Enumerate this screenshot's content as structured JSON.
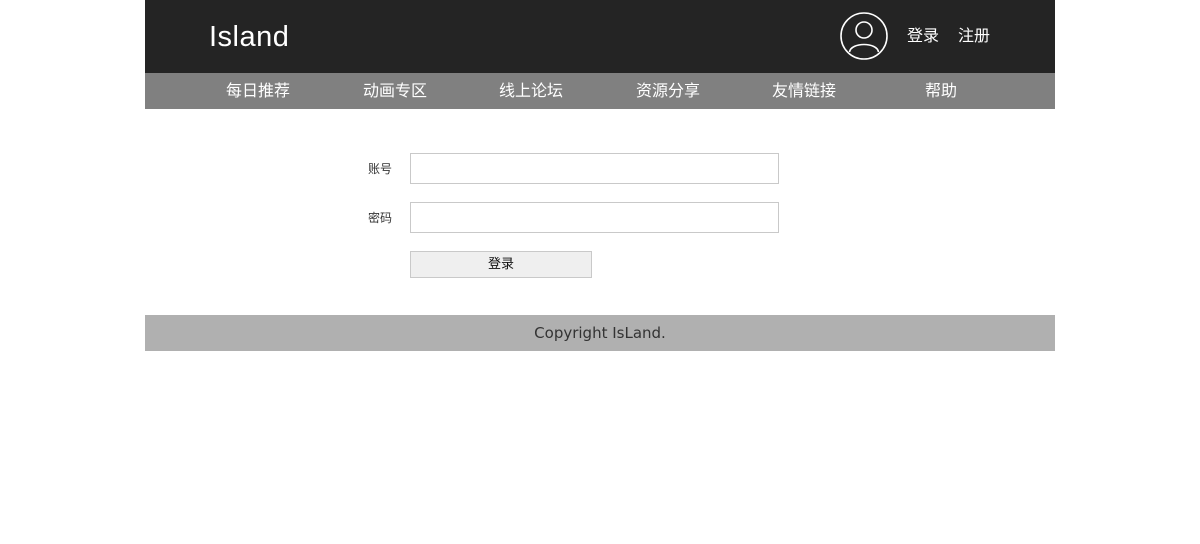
{
  "header": {
    "logo": "Island",
    "avatar_icon": "user-avatar-icon",
    "login_label": "登录",
    "register_label": "注册"
  },
  "nav": {
    "items": [
      {
        "label": "每日推荐"
      },
      {
        "label": "动画专区"
      },
      {
        "label": "线上论坛"
      },
      {
        "label": "资源分享"
      },
      {
        "label": "友情链接"
      },
      {
        "label": "帮助"
      }
    ]
  },
  "form": {
    "account_label": "账号",
    "account_value": "",
    "password_label": "密码",
    "password_value": "",
    "submit_label": "登录"
  },
  "footer": {
    "copyright": "Copyright IsLand."
  },
  "colors": {
    "header_bg": "#242424",
    "nav_bg": "#808080",
    "footer_bg": "#b0b0b0",
    "input_border": "#c9c9c9",
    "button_bg": "#efefef"
  }
}
